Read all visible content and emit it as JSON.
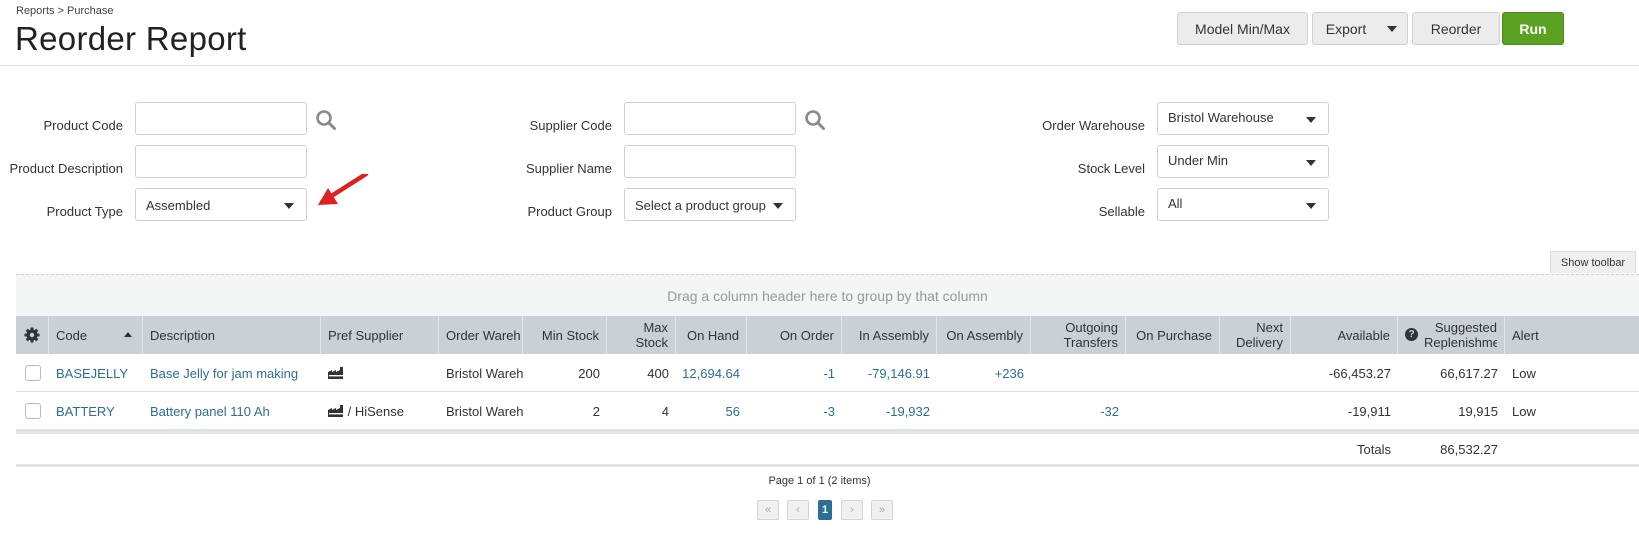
{
  "header": {
    "breadcrumb": "Reports > Purchase",
    "title": "Reorder Report",
    "buttons": {
      "model_min_max": "Model Min/Max",
      "export": "Export",
      "reorder": "Reorder",
      "run": "Run"
    }
  },
  "filters": {
    "product_code": {
      "label": "Product Code",
      "value": ""
    },
    "product_description": {
      "label": "Product Description",
      "value": ""
    },
    "product_type": {
      "label": "Product Type",
      "value": "Assembled"
    },
    "supplier_code": {
      "label": "Supplier Code",
      "value": ""
    },
    "supplier_name": {
      "label": "Supplier Name",
      "value": ""
    },
    "product_group": {
      "label": "Product Group",
      "value": "Select a product group"
    },
    "order_warehouse": {
      "label": "Order Warehouse",
      "value": "Bristol Warehouse"
    },
    "stock_level": {
      "label": "Stock Level",
      "value": "Under Min"
    },
    "sellable": {
      "label": "Sellable",
      "value": "All"
    }
  },
  "grid": {
    "show_toolbar": "Show toolbar",
    "group_hint": "Drag a column header here to group by that column",
    "columns": {
      "code": "Code",
      "description": "Description",
      "pref_supplier": "Pref Supplier",
      "order_warehouse": "Order Wareh",
      "min_stock": "Min Stock",
      "max_stock": "Max Stock",
      "on_hand": "On Hand",
      "on_order": "On Order",
      "in_assembly": "In Assembly",
      "on_assembly": "On Assembly",
      "outgoing_transfers": "Outgoing Transfers",
      "on_purchase": "On Purchase",
      "next_delivery": "Next Delivery",
      "available": "Available",
      "suggested_replenishment": "Suggested Replenishment",
      "alert": "Alert"
    },
    "rows": [
      {
        "code": "BASEJELLY",
        "description": "Base Jelly for jam making",
        "pref_supplier": "",
        "order_warehouse": "Bristol Warehouse",
        "min_stock": "200",
        "max_stock": "400",
        "on_hand": "12,694.64",
        "on_order": "-1",
        "in_assembly": "-79,146.91",
        "on_assembly": "+236",
        "outgoing_transfers": "",
        "on_purchase": "",
        "next_delivery": "",
        "available": "-66,453.27",
        "suggested_replenishment": "66,617.27",
        "alert": "Low"
      },
      {
        "code": "BATTERY",
        "description": "Battery panel 110 Ah",
        "pref_supplier": " / HiSense",
        "order_warehouse": "Bristol Warehouse",
        "min_stock": "2",
        "max_stock": "4",
        "on_hand": "56",
        "on_order": "-3",
        "in_assembly": "-19,932",
        "on_assembly": "",
        "outgoing_transfers": "-32",
        "on_purchase": "",
        "next_delivery": "",
        "available": "-19,911",
        "suggested_replenishment": "19,915",
        "alert": "Low"
      }
    ],
    "totals": {
      "label": "Totals",
      "suggested_replenishment": "86,532.27"
    }
  },
  "pager": {
    "info": "Page 1 of 1 (2 items)",
    "current_page": "1",
    "first": "«",
    "prev": "‹",
    "next": "›",
    "last": "»"
  },
  "colors": {
    "accent": "#2e6e96",
    "run": "#5ca222",
    "arrow": "#e02020",
    "header_bg": "#c9d0d6"
  }
}
